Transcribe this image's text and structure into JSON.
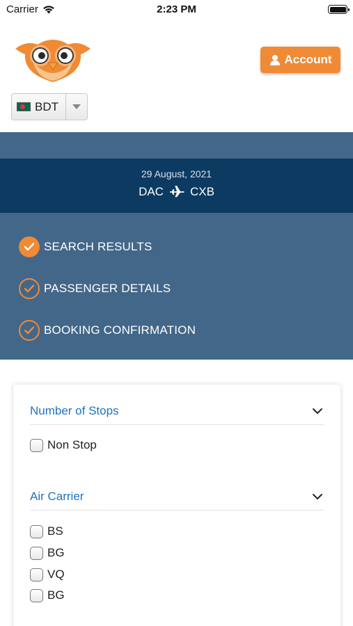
{
  "status_bar": {
    "carrier": "Carrier",
    "time": "2:23 PM",
    "icons": [
      "wifi-icon",
      "battery-icon"
    ]
  },
  "header": {
    "logo": "owl-logo",
    "account_label": "Account",
    "account_icon": "user-icon",
    "currency": {
      "selected": "BDT",
      "flag": "bangladesh-flag-icon"
    }
  },
  "trip": {
    "date": "29 August, 2021",
    "from": "DAC",
    "to": "CXB",
    "icon": "plane-icon"
  },
  "steps": [
    {
      "label": "SEARCH RESULTS",
      "state": "active"
    },
    {
      "label": "PASSENGER DETAILS",
      "state": "pending"
    },
    {
      "label": "BOOKING CONFIRMATION",
      "state": "pending"
    }
  ],
  "filters": {
    "stops": {
      "title": "Number of Stops",
      "options": [
        {
          "label": "Non Stop",
          "checked": false
        }
      ]
    },
    "carrier": {
      "title": "Air Carrier",
      "options": [
        {
          "label": "BS",
          "checked": false
        },
        {
          "label": "BG",
          "checked": false
        },
        {
          "label": "VQ",
          "checked": false
        },
        {
          "label": "BG",
          "checked": false
        }
      ]
    }
  },
  "colors": {
    "accent_orange": "#f08a35",
    "band_blue": "#436789",
    "trip_navy": "#0c3a61",
    "filter_title_blue": "#1d73c2"
  }
}
